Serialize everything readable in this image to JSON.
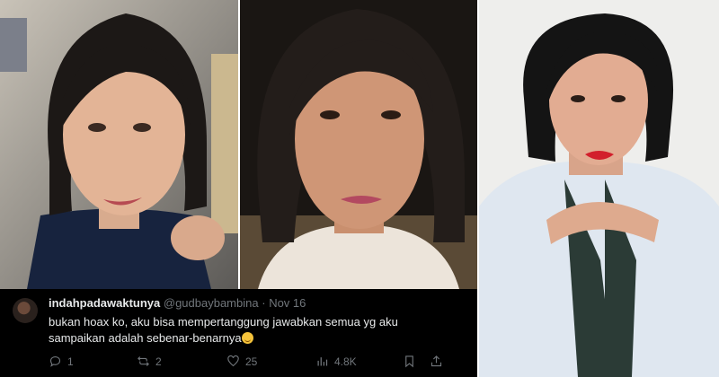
{
  "tweet": {
    "display_name": "indahpadawaktunya",
    "handle": "@gudbaybambina",
    "separator": "·",
    "date": "Nov 16",
    "text": "bukan hoax ko, aku bisa mempertanggung jawabkan semua yg aku sampaikan adalah sebenar-benarnya",
    "emoji_icon": "smiling-face-emoji-icon",
    "reply_icon": "reply-icon",
    "reply_count": "1",
    "retweet_icon": "retweet-icon",
    "retweet_count": "2",
    "like_icon": "heart-icon",
    "like_count": "25",
    "views_icon": "views-icon",
    "views_count": "4.8K",
    "bookmark_icon": "bookmark-icon",
    "share_icon": "share-icon"
  },
  "colors": {
    "tweet_background": "#000000",
    "tweet_text": "#e7e9ea",
    "tweet_muted": "#71767b"
  }
}
